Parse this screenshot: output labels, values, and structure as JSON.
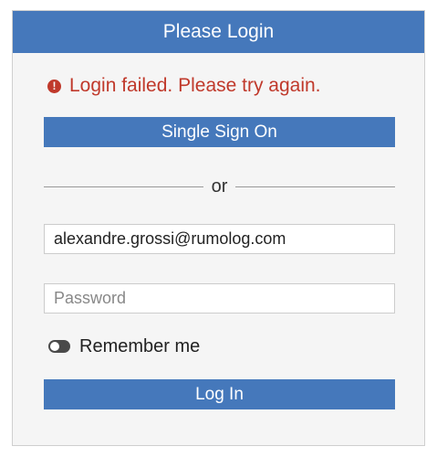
{
  "panel": {
    "title": "Please Login"
  },
  "error": {
    "icon": "exclamation-circle-icon",
    "icon_glyph": "!",
    "message": "Login failed. Please try again."
  },
  "sso_button": {
    "label": "Single Sign On"
  },
  "divider": {
    "text": "or"
  },
  "email_field": {
    "value": "alexandre.grossi@rumolog.com"
  },
  "password_field": {
    "value": "",
    "placeholder": "Password"
  },
  "remember": {
    "label": "Remember me",
    "checked": false
  },
  "login_button": {
    "label": "Log In"
  },
  "colors": {
    "accent": "#4578bb",
    "error": "#c0392b",
    "panel_background": "#f5f5f5"
  }
}
